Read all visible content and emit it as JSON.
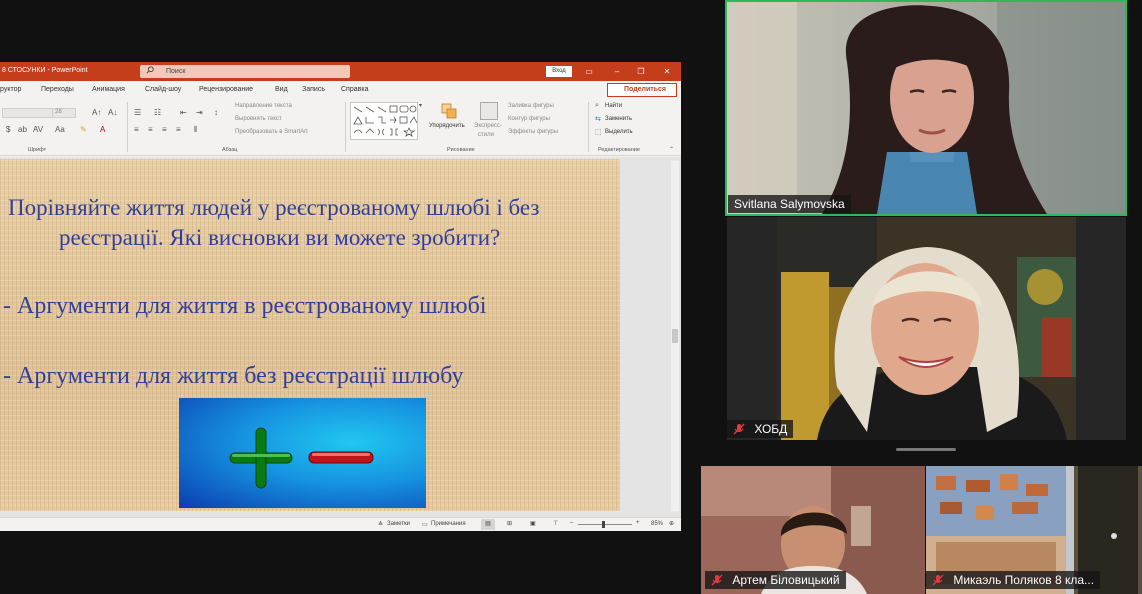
{
  "powerpoint": {
    "title": "8 СТОСУНКИ  -  PowerPoint",
    "search_placeholder": "Поиск",
    "signin_label": "Вход",
    "ribbon_tabs": [
      "руктор",
      "Переходы",
      "Анимация",
      "Слайд-шоу",
      "Рецензирование",
      "Вид",
      "Запись",
      "Справка"
    ],
    "share_label": "Поделиться",
    "ribbon": {
      "text_direction": "Направление текста",
      "align_text": "Выровнять текст",
      "convert_smartart": "Преобразовать в SmartArt",
      "arrange": "Упорядочить",
      "quick_styles_1": "Экспресс-",
      "quick_styles_2": "стили",
      "shape_fill": "Заливка фигуры",
      "shape_outline": "Контур фигуры",
      "shape_effects": "Эффекты фигуры",
      "find": "Найти",
      "replace": "Заменить",
      "select": "Выделить",
      "font_size": "28",
      "groups": {
        "font": "Шрифт",
        "paragraph": "Абзац",
        "drawing": "Рисование",
        "editing": "Редактирование"
      }
    },
    "slide": {
      "question_line1": "Порівняйте життя людей у реєстрованому шлюбі і без",
      "question_line2": "реєстрації. Які висновки ви можете зробити?",
      "bullet1": "- Аргументи для життя в реєстрованому шлюбі",
      "bullet2": "- Аргументи для життя без реєстрації шлюбу",
      "image_description": "plus-minus symbols"
    },
    "status": {
      "notes": "Заметки",
      "comments": "Примечания",
      "zoom": "85%"
    }
  },
  "participants": [
    {
      "name": "Svitlana Salymovska",
      "muted": false,
      "active_speaker": true
    },
    {
      "name": "ХОБД",
      "muted": true,
      "active_speaker": false
    },
    {
      "name": "Артем Біловицький",
      "muted": true,
      "active_speaker": false
    },
    {
      "name": "Микаэль Поляков 8 кла...",
      "muted": true,
      "active_speaker": false
    }
  ],
  "colors": {
    "ppt_accent": "#c43e1c",
    "speaker_border": "#2fb85a",
    "slide_text": "#30409a",
    "mic_muted": "#e0393e"
  }
}
